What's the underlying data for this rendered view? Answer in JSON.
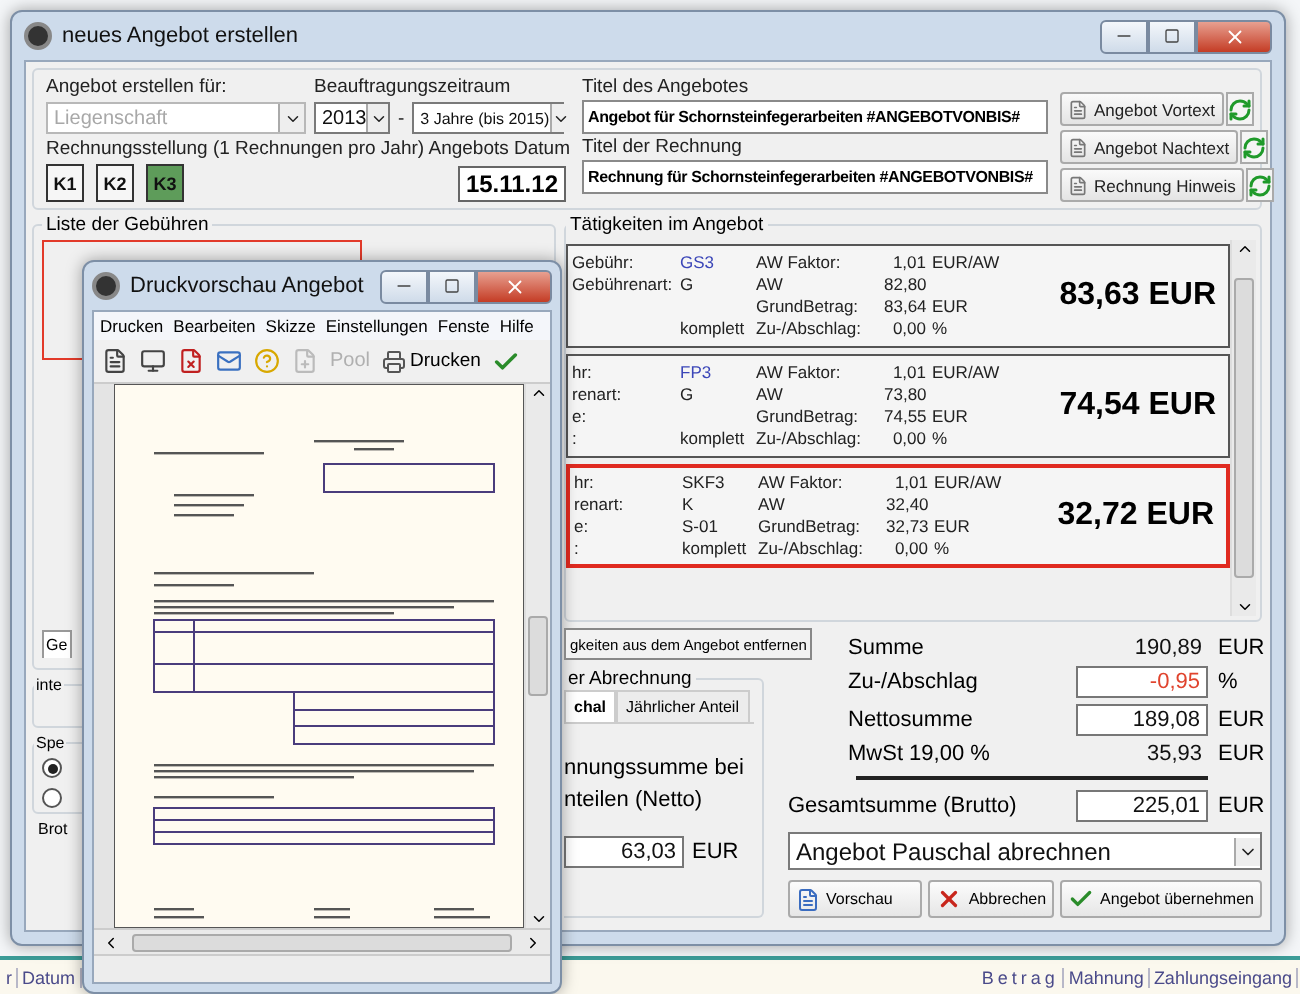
{
  "dialog": {
    "title": "neues Angebot erstellen",
    "header": {
      "target_label": "Angebot erstellen für:",
      "target": {
        "value": "Liegenschaft",
        "disabled": true
      },
      "period_label": "Beauftragungszeitraum",
      "year": "2013",
      "separator": "-",
      "duration": "3 Jahre (bis 2015)",
      "billing_note": "Rechnungsstellung (1 Rechnungen pro Jahr)",
      "billing_buttons": [
        {
          "label": "K1",
          "selected": false
        },
        {
          "label": "K2",
          "selected": false
        },
        {
          "label": "K3",
          "selected": true
        }
      ],
      "date_label": "Angebots Datum",
      "date": "15.11.12",
      "offer_title_label": "Titel des Angebotes",
      "offer_title": "Angebot für Schornsteinfegerarbeiten #ANGEBOTVONBIS#",
      "invoice_title_label": "Titel der Rechnung",
      "invoice_title": "Rechnung für Schornsteinfegerarbeiten #ANGEBOTVONBIS#",
      "text_buttons": [
        "Angebot Vortext",
        "Angebot Nachtext",
        "Rechnung Hinweis"
      ]
    },
    "fee_list": {
      "title": "Liste der Gebühren",
      "tab": "Ge",
      "group_1": "inte",
      "group_2": "Spe",
      "radios": [
        {
          "selected": true
        },
        {
          "selected": false
        }
      ],
      "label": "Brot"
    },
    "activities": {
      "title": "Tätigkeiten im Angebot",
      "cards": [
        {
          "linked": true,
          "selected": false,
          "total": "83,63 EUR",
          "rows": [
            {
              "label": "Gebühr:",
              "value": "GS3",
              "key": "AW Faktor:",
              "amount": "1,01",
              "unit": "EUR/AW"
            },
            {
              "label": "Gebührenart:",
              "value": "G",
              "key": "AW",
              "amount": "82,80"
            },
            {
              "key": "GrundBetrag:",
              "amount": "83,64",
              "unit": "EUR"
            },
            {
              "value": "komplett",
              "key": "Zu-/Abschlag:",
              "amount": "0,00",
              "unit": "%"
            }
          ]
        },
        {
          "linked": true,
          "selected": false,
          "total": "74,54 EUR",
          "rows": [
            {
              "label": "hr:",
              "value": "FP3",
              "key": "AW Faktor:",
              "amount": "1,01",
              "unit": "EUR/AW"
            },
            {
              "label": "renart:",
              "value": "G",
              "key": "AW",
              "amount": "73,80"
            },
            {
              "label": "e:",
              "key": "GrundBetrag:",
              "amount": "74,55",
              "unit": "EUR"
            },
            {
              "label": ":",
              "value": "komplett",
              "key": "Zu-/Abschlag:",
              "amount": "0,00",
              "unit": "%"
            }
          ]
        },
        {
          "linked": false,
          "selected": true,
          "total": "32,72 EUR",
          "rows": [
            {
              "label": "hr:",
              "value": "SKF3",
              "key": "AW Faktor:",
              "amount": "1,01",
              "unit": "EUR/AW"
            },
            {
              "label": "renart:",
              "value": "K",
              "key": "AW",
              "amount": "32,40"
            },
            {
              "label": "e:",
              "value": "S-01",
              "key": "GrundBetrag:",
              "amount": "32,73",
              "unit": "EUR"
            },
            {
              "label": ":",
              "value": "komplett",
              "key": "Zu-/Abschlag:",
              "amount": "0,00",
              "unit": "%"
            }
          ]
        }
      ]
    },
    "remove_button": "gkeiten aus dem Angebot entfernen",
    "billing_panel": {
      "title": "er Abrechnung",
      "tabs": [
        {
          "label": "chal",
          "selected": true
        },
        {
          "label": "Jährlicher Anteil",
          "selected": false
        }
      ],
      "text_lines": [
        "nnungssumme bei",
        "nteilen (Netto)"
      ],
      "value": "63,03",
      "unit": "EUR"
    },
    "summary": [
      {
        "kind": "plain",
        "label": "Summe",
        "value": "190,89",
        "unit": "EUR",
        "alert": false
      },
      {
        "kind": "field",
        "label": "Zu-/Abschlag",
        "value": "-0,95",
        "unit": "%",
        "alert": true
      },
      {
        "kind": "field",
        "label": "Nettosumme",
        "value": "189,08",
        "unit": "EUR",
        "alert": false
      },
      {
        "kind": "plain",
        "label": "MwSt 19,00 %",
        "value": "35,93",
        "unit": "EUR",
        "alert": false
      },
      {
        "kind": "total",
        "label": "Gesamtsumme (Brutto)",
        "value": "225,01",
        "unit": "EUR",
        "alert": false
      }
    ],
    "mode": "Angebot Pauschal abrechnen",
    "buttons": [
      {
        "kind": "preview",
        "label": "Vorschau"
      },
      {
        "kind": "cancel",
        "label": "Abbrechen"
      },
      {
        "kind": "accept",
        "label": "Angebot übernehmen"
      }
    ]
  },
  "preview": {
    "title": "Druckvorschau Angebot",
    "menu": [
      "Drucken",
      "Bearbeiten",
      "Skizze",
      "Einstellungen",
      "Fenste",
      "Hilfe"
    ],
    "pool": {
      "label": "Pool",
      "disabled": true
    },
    "print": "Drucken"
  },
  "background_columns": {
    "left": [
      "r",
      "Datum"
    ],
    "right": [
      "Betrag",
      "Mahnung",
      "Zahlungseingang"
    ]
  }
}
